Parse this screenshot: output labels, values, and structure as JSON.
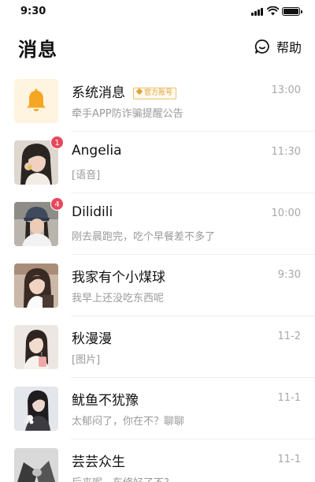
{
  "status_bar": {
    "time": "9:30"
  },
  "header": {
    "title": "消息",
    "help_label": "帮助"
  },
  "conversations": [
    {
      "name": "系统消息",
      "tag": "官方账号",
      "preview": "牵手APP防诈骗提醒公告",
      "time": "13:00"
    },
    {
      "name": "Angelia",
      "preview": "[语音]",
      "time": "11:30",
      "unread": "1"
    },
    {
      "name": "Dilidili",
      "preview": "刚去晨跑完，吃个早餐差不多了",
      "time": "10:00",
      "unread": "4"
    },
    {
      "name": "我家有个小煤球",
      "preview": "我早上还没吃东西呢",
      "time": "9:30"
    },
    {
      "name": "秋漫漫",
      "preview": "[图片]",
      "time": "11-2"
    },
    {
      "name": "鱿鱼不犹豫",
      "preview": "太郁闷了，你在不？聊聊",
      "time": "11-1"
    },
    {
      "name": "芸芸众生",
      "preview": "后来呢，车修好了不?",
      "time": "11-1"
    }
  ],
  "colors": {
    "accent_orange": "#f5a623",
    "badge_red": "#e8475b",
    "official_tag": "#e0a33e"
  }
}
